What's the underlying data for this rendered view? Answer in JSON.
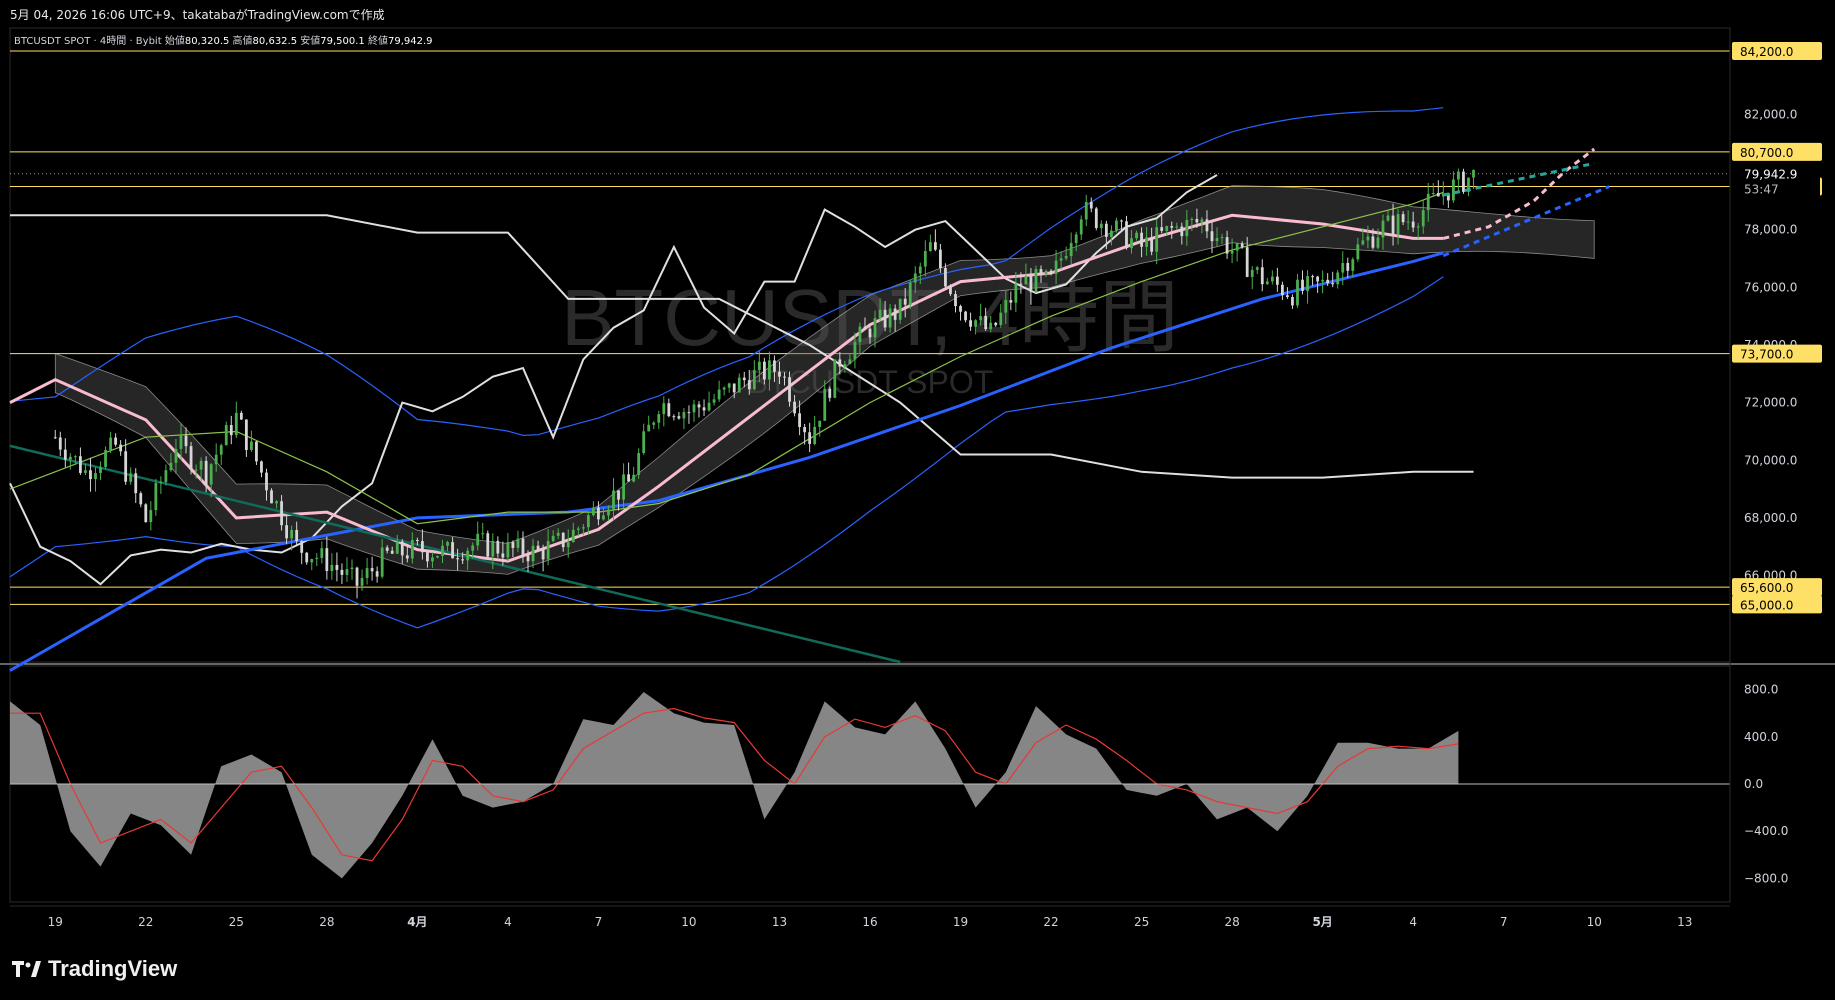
{
  "caption": "5月 04, 2026 16:06 UTC+9、takatabaがTradingView.comで作成",
  "watermark": {
    "line1": "BTCUSDT, 4時間",
    "line2": "BTCUSDT SPOT"
  },
  "branding": {
    "logo_text": "TradingView"
  },
  "colors": {
    "background": "#000000",
    "bull": "#4caf50",
    "bear": "#d6d6d6",
    "level_line": "#ffe066",
    "price_tag_bg": "#ffe066",
    "ma_blue": "#2962ff",
    "ma_pink": "#f8bbd0",
    "ma_green": "#8bc34a",
    "bollinger": "#2962ff",
    "ichimoku_cloud": "#555555",
    "lagging_line": "#e0e0e0",
    "oscillator_area": "#9e9e9e",
    "oscillator_signal": "#e53935"
  },
  "chart_data": [
    {
      "type": "candlestick",
      "symbol_info": {
        "symbol": "BTCUSDT SPOT · 4時間 · Bybit",
        "open_label": "始値",
        "open": "80,320.5",
        "high_label": "高値",
        "high": "80,632.5",
        "low_label": "安値",
        "low": "79,500.1",
        "close_label": "終値",
        "close": "79,942.9"
      },
      "x_tick_labels": [
        "19",
        "22",
        "25",
        "28",
        "4月",
        "4",
        "7",
        "10",
        "13",
        "16",
        "19",
        "22",
        "25",
        "28",
        "5月",
        "4",
        "7",
        "10",
        "13"
      ],
      "x_ticks_day_index": [
        0,
        3,
        6,
        9,
        12,
        15,
        18,
        21,
        24,
        27,
        30,
        33,
        36,
        39,
        42,
        45,
        48,
        51,
        54
      ],
      "x_range_days": [
        -1.5,
        55.5
      ],
      "ylim": [
        63000,
        85000
      ],
      "y_tick_values": [
        66000,
        68000,
        70000,
        72000,
        74000,
        76000,
        78000,
        80000,
        82000
      ],
      "y_tick_labels": [
        "66,000.0",
        "68,000.0",
        "70,000.0",
        "72,000.0",
        "74,000.0",
        "76,000.0",
        "78,000.0",
        "80,000.0",
        "82,000.0"
      ],
      "horizontal_levels": [
        {
          "value": 84200,
          "label": "84,200.0"
        },
        {
          "value": 80700,
          "label": "80,700.0"
        },
        {
          "value": 79500,
          "label": "79,500.0"
        },
        {
          "value": 73700,
          "label": "73,700.0"
        },
        {
          "value": 65600,
          "label": "65,600.0"
        },
        {
          "value": 65000,
          "label": "65,000.0"
        }
      ],
      "current_price": {
        "value": 79942.9,
        "label": "79,942.9",
        "countdown": "53:47"
      },
      "price_path_days": [
        0,
        1,
        2,
        3,
        4,
        5,
        6,
        7,
        8,
        9,
        10,
        11,
        12,
        13,
        14,
        15,
        16,
        17,
        18,
        19,
        20,
        21,
        22,
        23,
        24,
        25,
        26,
        27,
        28,
        29,
        30,
        31,
        32,
        33,
        34,
        35,
        36,
        37,
        38,
        39,
        40,
        41,
        42,
        43,
        44,
        45,
        46,
        47
      ],
      "price_path": [
        70800,
        69600,
        70500,
        67900,
        70600,
        69600,
        71500,
        69200,
        67000,
        66500,
        65700,
        66700,
        66900,
        66800,
        67100,
        66900,
        66800,
        67300,
        68400,
        69200,
        72000,
        71700,
        72200,
        72900,
        73200,
        70800,
        73500,
        74600,
        75200,
        77400,
        75300,
        74400,
        76200,
        76200,
        78700,
        78100,
        77400,
        78000,
        78300,
        77300,
        76300,
        75800,
        76100,
        77200,
        78100,
        78400,
        79300,
        79900
      ],
      "moving_averages": [
        {
          "name": "MA-long",
          "color": "#2962ff",
          "days": [
            -1.5,
            5,
            12,
            17,
            20,
            25,
            30,
            35,
            40,
            45,
            46
          ],
          "values": [
            62700,
            66600,
            68000,
            68200,
            68600,
            70100,
            71900,
            73900,
            75600,
            76900,
            77200
          ]
        },
        {
          "name": "MA-mid",
          "color": "#f8bbd0",
          "days": [
            -1.5,
            0,
            3,
            6,
            9,
            12,
            15,
            18,
            20,
            23,
            27,
            30,
            33,
            36,
            39,
            42,
            45,
            46
          ],
          "values": [
            72000,
            72800,
            71400,
            68000,
            68200,
            66900,
            66500,
            67600,
            69100,
            71500,
            74700,
            76200,
            76500,
            77600,
            78500,
            78200,
            77700,
            77700
          ]
        },
        {
          "name": "MA-short",
          "color": "#8bc34a",
          "days": [
            -1.5,
            3,
            6,
            9,
            12,
            15,
            18,
            20,
            23,
            27,
            30,
            33,
            36,
            39,
            42,
            45,
            46
          ],
          "values": [
            69000,
            70800,
            71000,
            69600,
            67800,
            68200,
            68200,
            68500,
            69500,
            72000,
            73600,
            75000,
            76200,
            77300,
            78100,
            78900,
            79300
          ]
        }
      ],
      "projection_lines": [
        {
          "name": "pink-projection",
          "color": "#f8bbd0",
          "days": [
            46,
            47.5,
            49,
            50,
            51
          ],
          "values": [
            77700,
            78100,
            79000,
            80000,
            80800
          ]
        },
        {
          "name": "green-projection",
          "color": "#26a69a",
          "days": [
            46,
            51
          ],
          "values": [
            79200,
            80300
          ]
        },
        {
          "name": "blue-projection",
          "color": "#2962ff",
          "days": [
            46,
            51.5
          ],
          "values": [
            77100,
            79500
          ]
        }
      ],
      "oscillator": {
        "type": "area+signal",
        "ylim": [
          -1000,
          1000
        ],
        "y_tick_values": [
          800,
          400,
          0,
          -400,
          -800
        ],
        "y_tick_labels": [
          "800.0",
          "400.0",
          "0.0",
          "−400.0",
          "−800.0"
        ],
        "days": [
          -1.5,
          -0.5,
          0.5,
          1.5,
          2.5,
          3.5,
          4.5,
          5.5,
          6.5,
          7.5,
          8.5,
          9.5,
          10.5,
          11.5,
          12.5,
          13.5,
          14.5,
          15.5,
          16.5,
          17.5,
          18.5,
          19.5,
          20.5,
          21.5,
          22.5,
          23.5,
          24.5,
          25.5,
          26.5,
          27.5,
          28.5,
          29.5,
          30.5,
          31.5,
          32.5,
          33.5,
          34.5,
          35.5,
          36.5,
          37.5,
          38.5,
          39.5,
          40.5,
          41.5,
          42.5,
          43.5,
          44.5,
          45.5,
          46.5
        ],
        "values": [
          700,
          500,
          -400,
          -700,
          -250,
          -350,
          -600,
          150,
          250,
          100,
          -600,
          -800,
          -500,
          -100,
          380,
          -100,
          -200,
          -150,
          0,
          550,
          500,
          780,
          600,
          520,
          500,
          -300,
          100,
          700,
          480,
          420,
          700,
          300,
          -200,
          100,
          660,
          420,
          300,
          -50,
          -100,
          0,
          -300,
          -200,
          -400,
          -100,
          350,
          350,
          300,
          300,
          450
        ],
        "signal": [
          600,
          600,
          0,
          -500,
          -400,
          -300,
          -500,
          -200,
          100,
          150,
          -200,
          -600,
          -650,
          -300,
          200,
          150,
          -100,
          -150,
          -50,
          300,
          450,
          600,
          640,
          560,
          520,
          200,
          0,
          400,
          550,
          480,
          580,
          450,
          100,
          0,
          350,
          500,
          380,
          200,
          0,
          -50,
          -150,
          -200,
          -250,
          -150,
          150,
          300,
          320,
          300,
          340
        ]
      }
    }
  ]
}
